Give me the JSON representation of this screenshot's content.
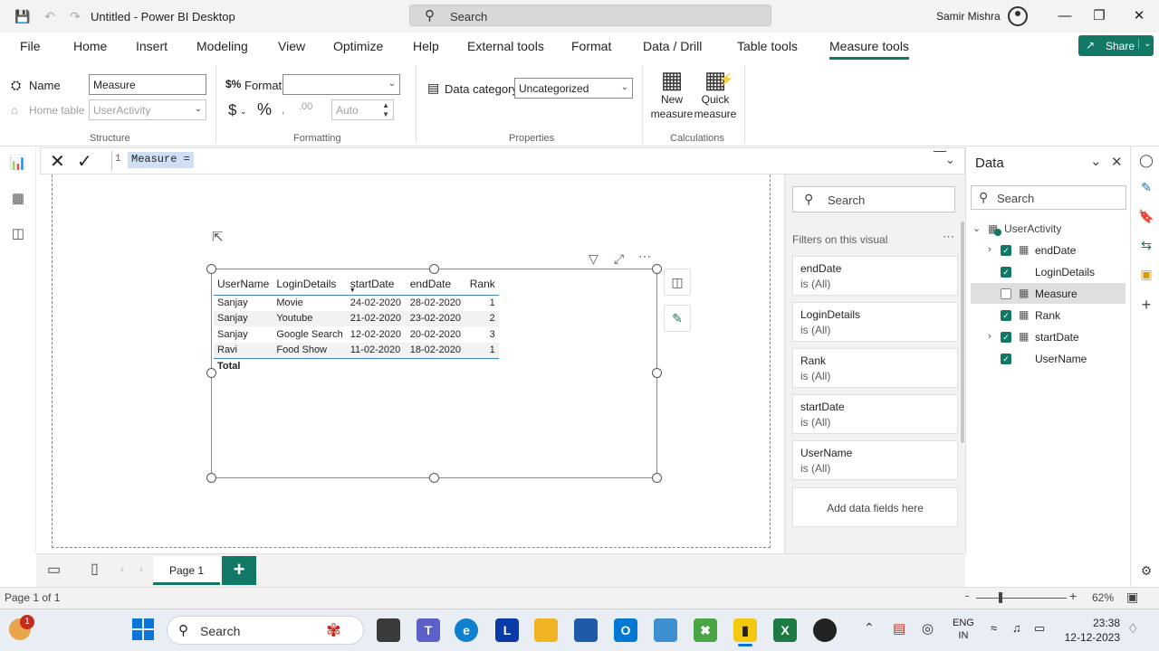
{
  "titlebar": {
    "title": "Untitled - Power BI Desktop",
    "search_placeholder": "Search",
    "user": "Samir Mishra"
  },
  "menu": {
    "items": [
      "File",
      "Home",
      "Insert",
      "Modeling",
      "View",
      "Optimize",
      "Help",
      "External tools",
      "Format",
      "Data / Drill",
      "Table tools",
      "Measure tools"
    ],
    "active": "Measure tools",
    "share": "Share"
  },
  "ribbon": {
    "structure": {
      "name_label": "Name",
      "name_value": "Measure",
      "home_table_label": "Home table",
      "home_table_value": "UserActivity",
      "group": "Structure"
    },
    "formatting": {
      "format_label": "Format",
      "format_value": "",
      "decimal_value": "Auto",
      "group": "Formatting"
    },
    "properties": {
      "data_category_label": "Data category",
      "data_category_value": "Uncategorized",
      "group": "Properties"
    },
    "calculations": {
      "new_measure": [
        "New",
        "measure"
      ],
      "quick_measure": [
        "Quick",
        "measure"
      ],
      "group": "Calculations"
    }
  },
  "formula": {
    "line": "1",
    "text": "Measure ="
  },
  "visual": {
    "columns": [
      "UserName",
      "LoginDetails",
      "startDate",
      "endDate",
      "Rank"
    ],
    "rows": [
      [
        "Sanjay",
        "Movie",
        "24-02-2020",
        "28-02-2020",
        "1"
      ],
      [
        "Sanjay",
        "Youtube",
        "21-02-2020",
        "23-02-2020",
        "2"
      ],
      [
        "Sanjay",
        "Google Search",
        "12-02-2020",
        "20-02-2020",
        "3"
      ],
      [
        "Ravi",
        "Food Show",
        "11-02-2020",
        "18-02-2020",
        "1"
      ]
    ],
    "total_label": "Total"
  },
  "filters": {
    "search_placeholder": "Search",
    "header": "Filters on this visual",
    "cards": [
      {
        "name": "endDate",
        "state": "is (All)"
      },
      {
        "name": "LoginDetails",
        "state": "is (All)"
      },
      {
        "name": "Rank",
        "state": "is (All)"
      },
      {
        "name": "startDate",
        "state": "is (All)"
      },
      {
        "name": "UserName",
        "state": "is (All)"
      }
    ],
    "add_fields": "Add data fields here"
  },
  "data_pane": {
    "title": "Data",
    "search_placeholder": "Search",
    "table": "UserActivity",
    "fields": [
      {
        "name": "endDate",
        "checked": true,
        "expandable": true
      },
      {
        "name": "LoginDetails",
        "checked": true,
        "expandable": false
      },
      {
        "name": "Measure",
        "checked": false,
        "expandable": false
      },
      {
        "name": "Rank",
        "checked": true,
        "expandable": false
      },
      {
        "name": "startDate",
        "checked": true,
        "expandable": true
      },
      {
        "name": "UserName",
        "checked": true,
        "expandable": false
      }
    ]
  },
  "pages": {
    "tab": "Page 1",
    "add": "+"
  },
  "status": {
    "page_info": "Page 1 of 1",
    "zoom": "62%"
  },
  "taskbar": {
    "search": "Search",
    "lang": [
      "ENG",
      "IN"
    ],
    "time": "23:38",
    "date": "12-12-2023",
    "badge": "1"
  },
  "colors": {
    "accent": "#117865",
    "table_rule": "#3a86c8"
  }
}
